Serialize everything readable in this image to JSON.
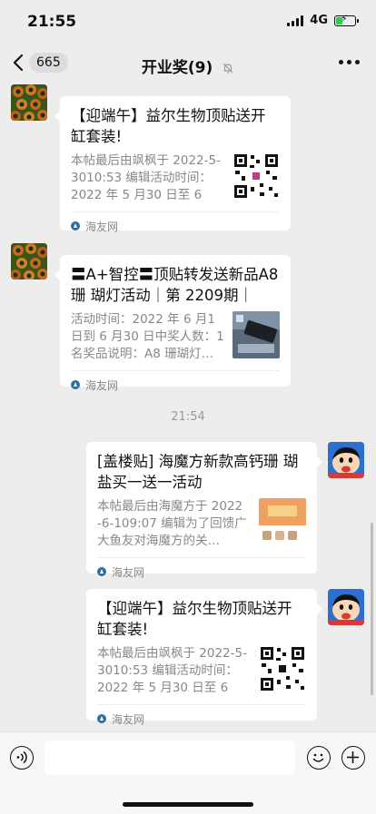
{
  "status": {
    "time": "21:55",
    "network": "4G"
  },
  "nav": {
    "back_count": "665",
    "title": "开业奖(9)"
  },
  "timestamp": "21:54",
  "messages": [
    {
      "title": "【迎端午】益尔生物顶贴送开缸套装!",
      "desc": "本帖最后由飒枫于 2022-5-3010:53 编辑活动时间：2022 年 5 月30 日至 6 月…",
      "source": "海友网",
      "thumb": "qr"
    },
    {
      "title": "〓A+智控〓顶贴转发送新品A8珊 瑚灯活动｜第 2209期｜",
      "desc": "活动时间：2022 年 6 月1 日到 6 月30 日中奖人数：1 名奖品说明：A8 珊瑚灯…",
      "source": "海友网",
      "thumb": "lamp"
    },
    {
      "title": "[盖楼贴] 海魔方新款高钙珊 瑚盐买一送一活动",
      "desc": "本帖最后由海魔方于 2022 -6-109:07 编辑为了回馈广大鱼友对海魔方的关…",
      "source": "海友网",
      "thumb": "salt"
    },
    {
      "title": "【迎端午】益尔生物顶贴送开缸套装!",
      "desc": "本帖最后由飒枫于 2022-5-3010:53 编辑活动时间：2022 年 5 月30 日至 6 月…",
      "source": "海友网",
      "thumb": "qr"
    }
  ]
}
